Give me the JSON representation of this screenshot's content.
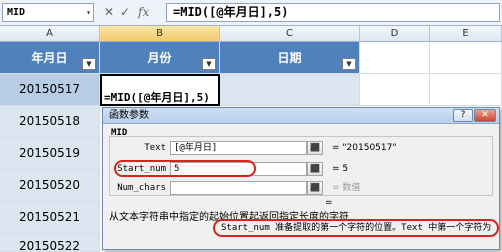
{
  "formula_bar": {
    "name_box": "MID",
    "name_box_arrow": "▾",
    "icon_cancel": "✕",
    "icon_enter": "✓",
    "icon_fx": "fx",
    "formula": "=MID([@年月日],5)"
  },
  "columns": [
    "A",
    "B",
    "C",
    "D",
    "E"
  ],
  "table": {
    "headers": [
      "年月日",
      "月份",
      "日期"
    ],
    "dropdown_glyph": "▼",
    "dates": [
      "20150517",
      "20150518",
      "20150519",
      "20150520",
      "20150521",
      "20150522"
    ],
    "edit_cell": "=MID([@年月日],5)"
  },
  "dialog": {
    "title": "函数参数",
    "help_label": "?",
    "close_label": "✕",
    "function_name": "MID",
    "args": [
      {
        "label": "Text",
        "value": "[@年月日]",
        "result": "= \"20150517\""
      },
      {
        "label": "Start_num",
        "value": "5",
        "result": "= 5"
      },
      {
        "label": "Num_chars",
        "value": "",
        "result": "= 数值"
      }
    ],
    "ref_button_glyph": "⬛",
    "equals": "=",
    "description": "从文本字符串中指定的起始位置起返回指定长度的字符",
    "arg_description": "Start_num  准备提取的第一个字符的位置。Text 中第一个字符为 1"
  },
  "colors": {
    "table_header": "#4f81bd",
    "band": "#dce6f1",
    "highlight": "#d9231a"
  }
}
